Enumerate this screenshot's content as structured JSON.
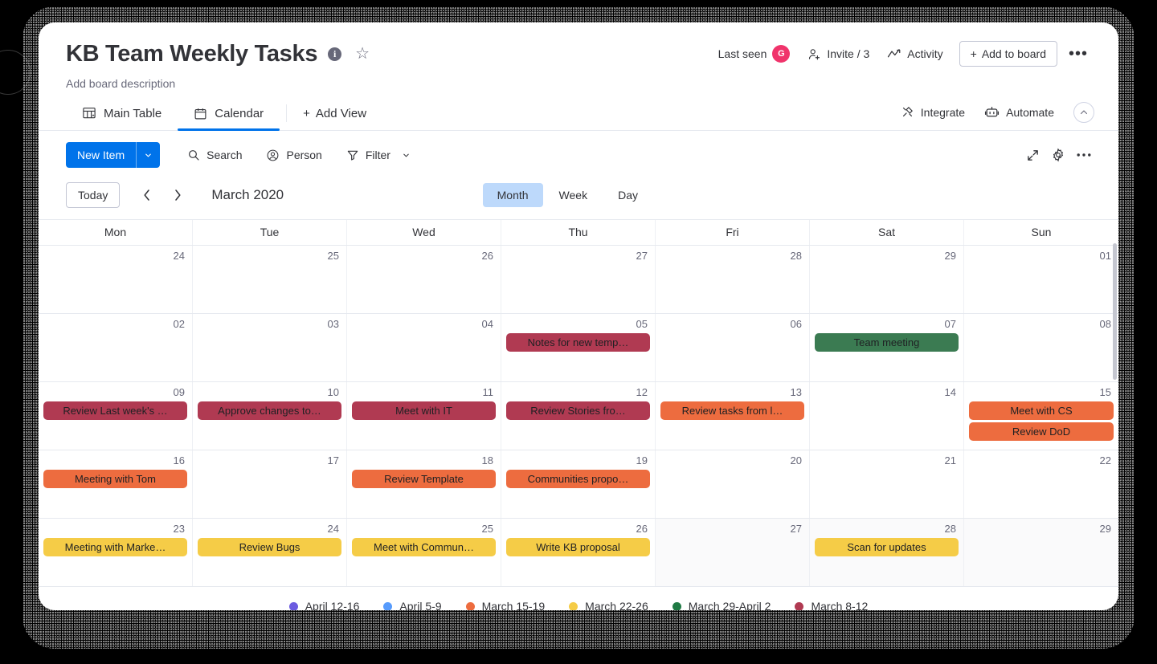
{
  "board": {
    "title": "KB Team Weekly Tasks",
    "description": "Add board description",
    "info_icon": "info-icon",
    "star_icon": "star-icon"
  },
  "header_right": {
    "last_seen_label": "Last seen",
    "avatar_initial": "G",
    "avatar_color": "#f0336b",
    "invite_label": "Invite / 3",
    "activity_label": "Activity",
    "add_to_board_label": "Add to board",
    "more_label": "•••"
  },
  "tabs": {
    "items": [
      {
        "label": "Main Table",
        "icon": "table-icon",
        "active": false
      },
      {
        "label": "Calendar",
        "icon": "calendar-icon",
        "active": true
      }
    ],
    "add_view_label": "Add View",
    "integrate_label": "Integrate",
    "automate_label": "Automate",
    "collapse_icon": "chevron-up-icon"
  },
  "toolbar": {
    "new_item_label": "New Item",
    "new_item_caret": "chevron-down-icon",
    "search_label": "Search",
    "person_label": "Person",
    "filter_label": "Filter",
    "filter_caret": "chevron-down-icon",
    "expand_icon": "expand-icon",
    "settings_icon": "gear-icon",
    "more_icon": "more-icon"
  },
  "calendar_nav": {
    "today_label": "Today",
    "prev_icon": "chevron-left-icon",
    "next_icon": "chevron-right-icon",
    "current_period": "March 2020",
    "views": [
      {
        "label": "Month",
        "active": true
      },
      {
        "label": "Week",
        "active": false
      },
      {
        "label": "Day",
        "active": false
      }
    ]
  },
  "calendar": {
    "weekdays": [
      "Mon",
      "Tue",
      "Wed",
      "Thu",
      "Fri",
      "Sat",
      "Sun"
    ],
    "colors": {
      "maroon": "#b03a52",
      "orange": "#ed6c3f",
      "yellow": "#f5cc47",
      "green": "#3b7b52",
      "purple": "#6c5ce0",
      "blue": "#579bfc"
    },
    "weeks": [
      {
        "days": [
          {
            "num": "24",
            "muted": false,
            "events": []
          },
          {
            "num": "25",
            "muted": false,
            "events": []
          },
          {
            "num": "26",
            "muted": false,
            "events": []
          },
          {
            "num": "27",
            "muted": false,
            "events": []
          },
          {
            "num": "28",
            "muted": false,
            "events": []
          },
          {
            "num": "29",
            "muted": false,
            "events": []
          },
          {
            "num": "01",
            "muted": false,
            "events": []
          }
        ]
      },
      {
        "days": [
          {
            "num": "02",
            "muted": false,
            "events": []
          },
          {
            "num": "03",
            "muted": false,
            "events": []
          },
          {
            "num": "04",
            "muted": false,
            "events": []
          },
          {
            "num": "05",
            "muted": false,
            "events": [
              {
                "title": "Notes for new temp…",
                "color": "#b03a52"
              }
            ]
          },
          {
            "num": "06",
            "muted": false,
            "events": []
          },
          {
            "num": "07",
            "muted": false,
            "events": [
              {
                "title": "Team meeting",
                "color": "#3b7b52"
              }
            ]
          },
          {
            "num": "08",
            "muted": false,
            "events": []
          }
        ]
      },
      {
        "days": [
          {
            "num": "09",
            "muted": false,
            "events": [
              {
                "title": "Review Last week's …",
                "color": "#b03a52"
              }
            ]
          },
          {
            "num": "10",
            "muted": false,
            "events": [
              {
                "title": "Approve changes to…",
                "color": "#b03a52"
              }
            ]
          },
          {
            "num": "11",
            "muted": false,
            "events": [
              {
                "title": "Meet with IT",
                "color": "#b03a52"
              }
            ]
          },
          {
            "num": "12",
            "muted": false,
            "events": [
              {
                "title": "Review Stories fro…",
                "color": "#b03a52"
              }
            ]
          },
          {
            "num": "13",
            "muted": false,
            "events": [
              {
                "title": "Review tasks from l…",
                "color": "#ed6c3f"
              }
            ]
          },
          {
            "num": "14",
            "muted": false,
            "events": []
          },
          {
            "num": "15",
            "muted": false,
            "events": [
              {
                "title": "Meet with CS",
                "color": "#ed6c3f"
              },
              {
                "title": "Review DoD",
                "color": "#ed6c3f"
              }
            ]
          }
        ]
      },
      {
        "days": [
          {
            "num": "16",
            "muted": false,
            "events": [
              {
                "title": "Meeting with Tom",
                "color": "#ed6c3f"
              }
            ]
          },
          {
            "num": "17",
            "muted": false,
            "events": []
          },
          {
            "num": "18",
            "muted": false,
            "events": [
              {
                "title": "Review Template",
                "color": "#ed6c3f"
              }
            ]
          },
          {
            "num": "19",
            "muted": false,
            "events": [
              {
                "title": "Communities propo…",
                "color": "#ed6c3f"
              }
            ]
          },
          {
            "num": "20",
            "muted": false,
            "events": []
          },
          {
            "num": "21",
            "muted": false,
            "events": []
          },
          {
            "num": "22",
            "muted": false,
            "events": []
          }
        ]
      },
      {
        "days": [
          {
            "num": "23",
            "muted": false,
            "events": [
              {
                "title": "Meeting with Marke…",
                "color": "#f5cc47"
              }
            ]
          },
          {
            "num": "24",
            "muted": false,
            "events": [
              {
                "title": "Review Bugs",
                "color": "#f5cc47"
              }
            ]
          },
          {
            "num": "25",
            "muted": false,
            "events": [
              {
                "title": "Meet with Commun…",
                "color": "#f5cc47"
              }
            ]
          },
          {
            "num": "26",
            "muted": false,
            "events": [
              {
                "title": "Write KB proposal",
                "color": "#f5cc47"
              }
            ]
          },
          {
            "num": "27",
            "muted": true,
            "events": []
          },
          {
            "num": "28",
            "muted": true,
            "events": [
              {
                "title": "Scan for updates",
                "color": "#f5cc47"
              }
            ]
          },
          {
            "num": "29",
            "muted": true,
            "events": []
          }
        ]
      }
    ]
  },
  "legend": [
    {
      "label": "April 12-16",
      "color": "#6c5ce0"
    },
    {
      "label": "April 5-9",
      "color": "#579bfc"
    },
    {
      "label": "March 15-19",
      "color": "#ed6c3f"
    },
    {
      "label": "March 22-26",
      "color": "#f5cc47"
    },
    {
      "label": "March 29-April 2",
      "color": "#1f7a44"
    },
    {
      "label": "March 8-12",
      "color": "#b03a52"
    }
  ]
}
